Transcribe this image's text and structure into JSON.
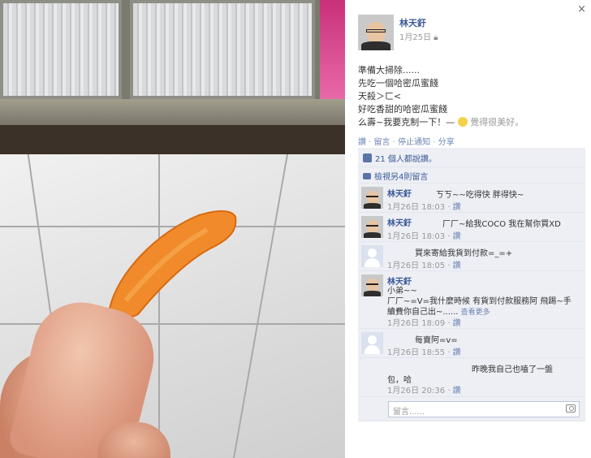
{
  "post": {
    "author": "林天釪",
    "date": "1月25日",
    "privacy_icon": "lock-icon",
    "lines": [
      "準備大掃除......",
      "先吃一個哈密瓜蜜餞",
      "天殺＞ㄈ<",
      "好吃香甜的哈密瓜蜜餞"
    ],
    "last_line": "么壽~我要克制一下！—",
    "feeling": "覺得很美好。"
  },
  "actions": {
    "like": "讚",
    "comment": "留言",
    "unfollow": "停止通知",
    "share": "分享"
  },
  "likes": {
    "text": "21 個人都說讚。"
  },
  "view_more": "檢視另4則留言",
  "comments": [
    {
      "name": "林天釪",
      "text": "ㄎㄎ~~吃得快 胖得快~",
      "time": "1月26日 18:03",
      "reply": "讚",
      "avatar": "person"
    },
    {
      "name": "林天釪",
      "text": "厂厂~給我COCO 我在幫你買XD",
      "time": "1月26日 18:03",
      "reply": "讚",
      "avatar": "person"
    },
    {
      "name": "",
      "text": "買來寄給我貨到付款=_=+",
      "time": "1月26日 18:05",
      "reply": "讚",
      "avatar": "blank"
    },
    {
      "name": "林天釪",
      "text_lines": [
        "小弟~~",
        "厂厂~=V=我什麼時候 有貨到付款服務阿 飛踢~手",
        "續費你自己出~......"
      ],
      "more": "查看更多",
      "time": "1月26日 18:09",
      "reply": "讚",
      "avatar": "person"
    },
    {
      "name": "",
      "text": "每賣阿=v=",
      "time": "1月26日 18:55",
      "reply": "讚",
      "avatar": "blank"
    },
    {
      "name": "",
      "text_lines": [
        "昨晚我自己也嗑了一盤",
        "包，哈"
      ],
      "time": "1月26日 20:36",
      "reply": "讚",
      "avatar": "none"
    }
  ],
  "reply_box": {
    "placeholder": "留言......"
  },
  "close": "×"
}
